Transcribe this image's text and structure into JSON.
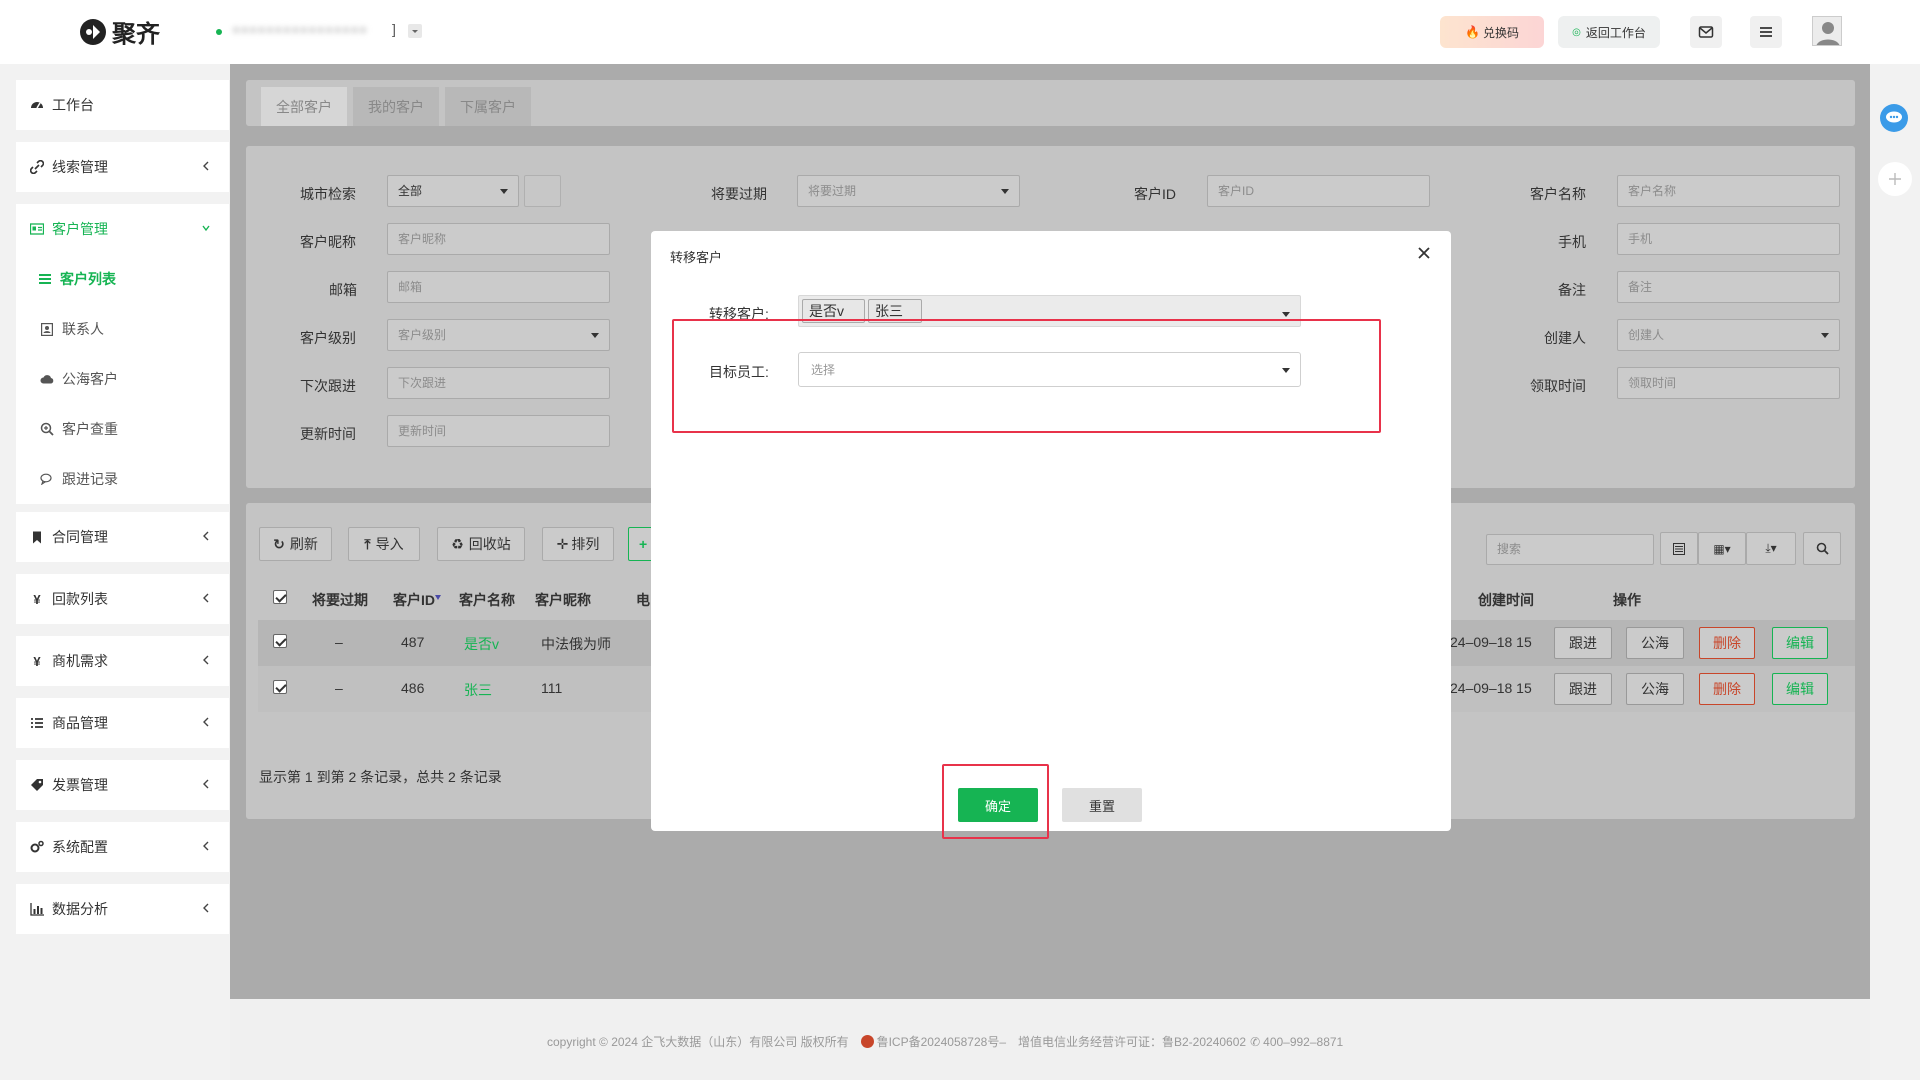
{
  "app": {
    "logo_text": "聚齐",
    "company_name": "●●●●●●●●●●●●●●●●",
    "company_bracket": "]"
  },
  "topbar": {
    "exchange_label": "兑换码",
    "return_label": "返回工作台"
  },
  "sidebar": {
    "items": [
      {
        "label": "工作台",
        "icon": "dashboard-icon"
      },
      {
        "label": "线索管理",
        "icon": "link-icon"
      },
      {
        "label": "客户管理",
        "icon": "id-card-icon"
      },
      {
        "label": "合同管理",
        "icon": "bookmark-icon"
      },
      {
        "label": "回款列表",
        "icon": "yen-icon"
      },
      {
        "label": "商机需求",
        "icon": "yen-icon"
      },
      {
        "label": "商品管理",
        "icon": "list-icon"
      },
      {
        "label": "发票管理",
        "icon": "tag-icon"
      },
      {
        "label": "系统配置",
        "icon": "gears-icon"
      },
      {
        "label": "数据分析",
        "icon": "bar-chart-icon"
      }
    ],
    "sub_items": [
      {
        "label": "客户列表",
        "icon": "list-icon"
      },
      {
        "label": "联系人",
        "icon": "contact-icon"
      },
      {
        "label": "公海客户",
        "icon": "cloud-icon"
      },
      {
        "label": "客户查重",
        "icon": "search-plus-icon"
      },
      {
        "label": "跟进记录",
        "icon": "comments-icon"
      }
    ]
  },
  "tabs": [
    "全部客户",
    "我的客户",
    "下属客户"
  ],
  "filters": {
    "city_label": "城市检索",
    "city_value": "全部",
    "expire_label": "将要过期",
    "expire_placeholder": "将要过期",
    "customer_id_label": "客户ID",
    "customer_id_placeholder": "客户ID",
    "customer_name_label": "客户名称",
    "customer_name_placeholder": "客户名称",
    "nickname_label": "客户昵称",
    "nickname_placeholder": "客户昵称",
    "phone_label": "手机",
    "phone_placeholder": "手机",
    "email_label": "邮箱",
    "email_placeholder": "邮箱",
    "remark_label": "备注",
    "remark_placeholder": "备注",
    "level_label": "客户级别",
    "level_placeholder": "客户级别",
    "creator_label": "创建人",
    "creator_placeholder": "创建人",
    "next_follow_label": "下次跟进",
    "next_follow_placeholder": "下次跟进",
    "claim_time_label": "领取时间",
    "claim_time_placeholder": "领取时间",
    "update_time_label": "更新时间",
    "update_time_placeholder": "更新时间"
  },
  "toolbar": {
    "refresh": "刷新",
    "import": "导入",
    "recycle": "回收站",
    "sort": "排列",
    "add": "+",
    "search_placeholder": "搜索"
  },
  "table": {
    "headers": {
      "expire": "将要过期",
      "id": "客户ID",
      "name": "客户名称",
      "nickname": "客户昵称",
      "phone": "电",
      "created": "创建时间",
      "ops": "操作"
    },
    "rows": [
      {
        "expire": "–",
        "id": "487",
        "name": "是否v",
        "nickname": "中法俄为师",
        "created": "24–09–18 15"
      },
      {
        "expire": "–",
        "id": "486",
        "name": "张三",
        "nickname": "111",
        "created": "24–09–18 15"
      }
    ],
    "row_actions": {
      "follow": "跟进",
      "public": "公海",
      "delete": "删除",
      "edit": "编辑"
    },
    "pagination": "显示第 1 到第 2 条记录，总共 2 条记录"
  },
  "modal": {
    "title": "转移客户",
    "transfer_label": "转移客户:",
    "selected_tags": [
      "是否v",
      "张三"
    ],
    "target_label": "目标员工:",
    "target_placeholder": "选择",
    "confirm": "确定",
    "reset": "重置"
  },
  "footer": {
    "copyright": "copyright © 2024 企飞大数据（山东）有限公司 版权所有",
    "icp": "鲁ICP备2024058728号–",
    "license": "增值电信业务经营许可证：鲁B2-20240602",
    "phone": "400–992–8871"
  },
  "colors": {
    "accent": "#16b453",
    "highlight_border": "#e8324a",
    "delete": "#c8462a"
  }
}
